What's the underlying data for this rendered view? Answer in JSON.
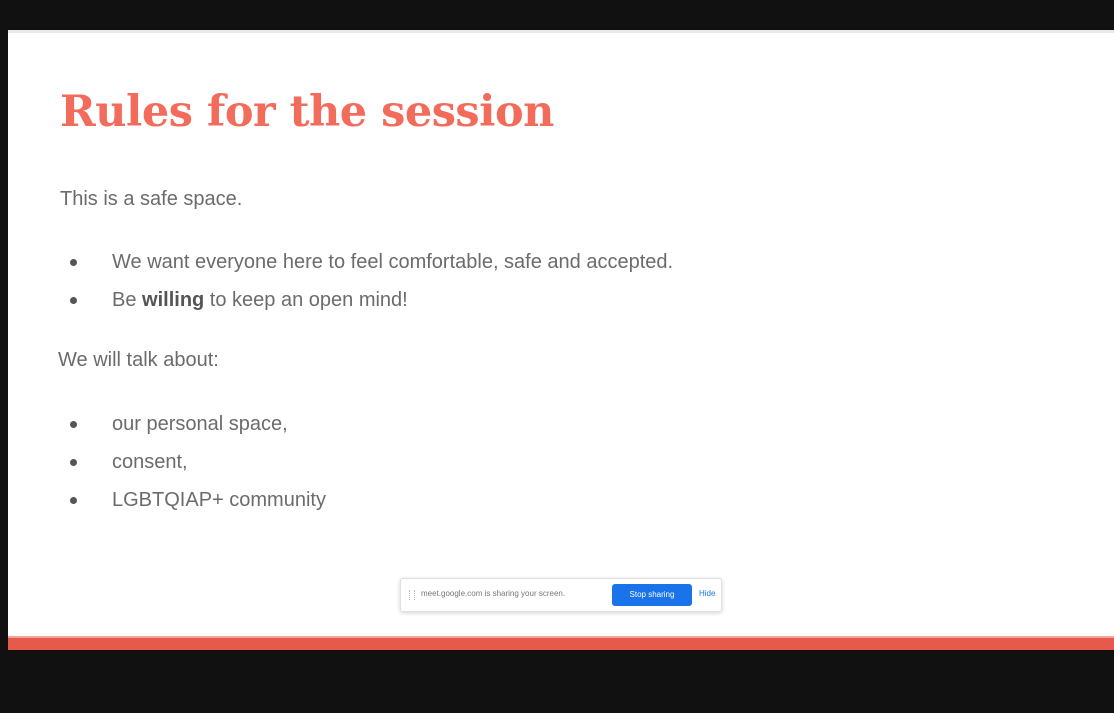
{
  "slide": {
    "title": "Rules for the session",
    "intro": "This is a safe space.",
    "rules": [
      {
        "before": "We want everyone here to feel comfortable, safe and accepted.",
        "bold": "",
        "after": ""
      },
      {
        "before": "Be ",
        "bold": "willing",
        "after": " to keep an open mind!"
      }
    ],
    "topics_heading": "We will talk about:",
    "topics": [
      "our personal space,",
      "consent,",
      "LGBTQIAP+ community"
    ]
  },
  "share_bar": {
    "message": "meet.google.com is sharing your screen.",
    "stop_label": "Stop sharing",
    "hide_label": "Hide"
  },
  "colors": {
    "title": "#f26b5b",
    "accent": "#e65a4c",
    "stop_button": "#1a73e8"
  }
}
